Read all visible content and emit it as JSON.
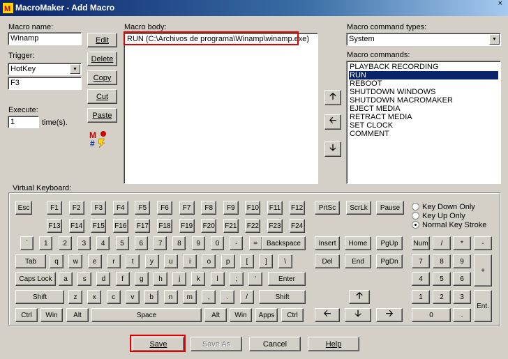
{
  "window": {
    "title": "MacroMaker - Add Macro",
    "close_glyph": "×"
  },
  "left": {
    "macro_name_label": "Macro name:",
    "macro_name_value": "Winamp",
    "trigger_label": "Trigger:",
    "trigger_value": "HotKey",
    "trigger_key_value": "F3",
    "execute_label": "Execute:",
    "execute_value": "1",
    "times_label": "time(s).",
    "edit_label": "Edit",
    "delete_label": "Delete",
    "copy_label": "Copy",
    "cut_label": "Cut",
    "paste_label": "Paste"
  },
  "body": {
    "label": "Macro body:",
    "lines": [
      "RUN (C:\\Archivos de programa\\Winamp\\winamp.exe)"
    ]
  },
  "commands": {
    "types_label": "Macro command types:",
    "types_value": "System",
    "list_label": "Macro commands:",
    "items": [
      "PLAYBACK RECORDING",
      "RUN",
      "REBOOT",
      "SHUTDOWN WINDOWS",
      "SHUTDOWN MACROMAKER",
      "EJECT MEDIA",
      "RETRACT MEDIA",
      "SET CLOCK",
      "COMMENT"
    ],
    "selected_index": 1
  },
  "keyboard": {
    "label": "Virtual Keyboard:",
    "esc": "Esc",
    "fkeys": [
      "F1",
      "F2",
      "F3",
      "F4",
      "F5",
      "F6",
      "F7",
      "F8",
      "F9",
      "F10",
      "F11",
      "F12"
    ],
    "fkeys2": [
      "F13",
      "F14",
      "F15",
      "F16",
      "F17",
      "F18",
      "F19",
      "F20",
      "F21",
      "F22",
      "F23",
      "F24"
    ],
    "printscr": "PrtSc",
    "scrlk": "ScrLk",
    "pause": "Pause",
    "num_row": [
      "`",
      "1",
      "2",
      "3",
      "4",
      "5",
      "6",
      "7",
      "8",
      "9",
      "0",
      "-",
      "="
    ],
    "backspace": "Backspace",
    "tab": "Tab",
    "qwe_row": [
      "q",
      "w",
      "e",
      "r",
      "t",
      "y",
      "u",
      "i",
      "o",
      "p",
      "[",
      "]",
      "\\"
    ],
    "caps": "Caps Lock",
    "asd_row": [
      "a",
      "s",
      "d",
      "f",
      "g",
      "h",
      "j",
      "k",
      "l",
      ";",
      "'"
    ],
    "enter": "Enter",
    "shift": "Shift",
    "zxc_row": [
      "z",
      "x",
      "c",
      "v",
      "b",
      "n",
      "m",
      ",",
      ".",
      "/"
    ],
    "ctrl": "Ctrl",
    "win": "Win",
    "alt": "Alt",
    "space": "Space",
    "apps": "Apps",
    "nav1": [
      "Insert",
      "Home",
      "PgUp"
    ],
    "nav2": [
      "Del",
      "End",
      "PgDn"
    ],
    "numpad_row1": [
      "Num",
      "/",
      "*",
      "-"
    ],
    "numpad_row2": [
      "7",
      "8",
      "9"
    ],
    "numpad_row3": [
      "4",
      "5",
      "6"
    ],
    "numpad_row4": [
      "1",
      "2",
      "3"
    ],
    "numpad_zero": "0",
    "numpad_dot": ".",
    "numpad_plus": "+",
    "numpad_enter": "Ent.",
    "radio": {
      "down": "Key Down Only",
      "up": "Key Up Only",
      "normal": "Normal Key Stroke",
      "selected": "normal"
    }
  },
  "footer": {
    "save": "Save",
    "save_as": "Save As",
    "cancel": "Cancel",
    "help": "Help"
  },
  "colors": {
    "highlight": "#e00000",
    "selection": "#0a246a",
    "face": "#d4d0c8"
  }
}
